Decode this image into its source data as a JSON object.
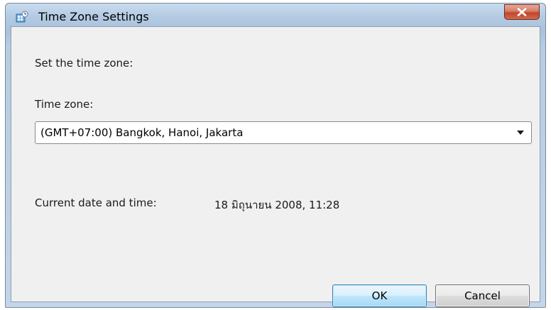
{
  "window": {
    "title": "Time Zone Settings"
  },
  "dialog": {
    "heading": "Set the time zone:",
    "timezone_label": "Time zone:",
    "timezone_value": "(GMT+07:00) Bangkok, Hanoi, Jakarta",
    "current_label": "Current date and time:",
    "current_value": "18 มิถุนายน 2008, 11:28"
  },
  "buttons": {
    "ok": "OK",
    "cancel": "Cancel"
  },
  "icons": {
    "title": "time-zone-settings-icon",
    "close": "close-icon",
    "dropdown": "dropdown-arrow-icon"
  },
  "colors": {
    "titlebar": "#b4cbe3",
    "dialog_bg": "#f0f0f0",
    "close_button": "#c0452c",
    "ok_button": "#bee6fd",
    "ok_border": "#3c7fb1"
  }
}
